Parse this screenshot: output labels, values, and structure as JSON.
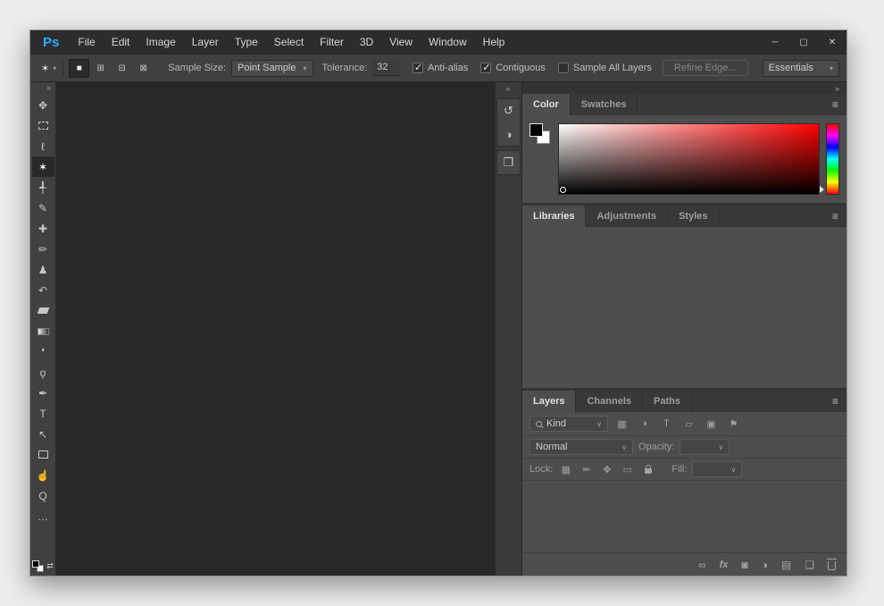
{
  "window": {
    "logo": "Ps",
    "minimize": "─",
    "maximize": "▢",
    "close": "✕"
  },
  "menubar": {
    "items": [
      "File",
      "Edit",
      "Image",
      "Layer",
      "Type",
      "Select",
      "Filter",
      "3D",
      "View",
      "Window",
      "Help"
    ]
  },
  "options": {
    "tool_icon_glyph": "✶",
    "caret": "▾",
    "selection_modes": [
      {
        "name": "new-selection",
        "glyph": "■"
      },
      {
        "name": "add-selection",
        "glyph": "⊞"
      },
      {
        "name": "subtract-selection",
        "glyph": "⊟"
      },
      {
        "name": "intersect-selection",
        "glyph": "⊠"
      }
    ],
    "sample_size_label": "Sample Size:",
    "sample_size_value": "Point Sample",
    "tolerance_label": "Tolerance:",
    "tolerance_value": "32",
    "anti_alias": {
      "label": "Anti-alias",
      "checked": true
    },
    "contiguous": {
      "label": "Contiguous",
      "checked": true
    },
    "sample_all_layers": {
      "label": "Sample All Layers",
      "checked": false
    },
    "refine_edge_label": "Refine Edge...",
    "workspace_value": "Essentials"
  },
  "toolbar": {
    "collapse": "»",
    "switch_colors_glyph": "⇄",
    "tools": [
      {
        "name": "move",
        "glyph": "✥"
      },
      {
        "name": "rectangular-marquee",
        "glyph": ""
      },
      {
        "name": "lasso",
        "glyph": "ℓ"
      },
      {
        "name": "magic-wand",
        "glyph": "✶",
        "selected": true
      },
      {
        "name": "crop",
        "glyph": "╃"
      },
      {
        "name": "eyedropper",
        "glyph": "✎"
      },
      {
        "name": "spot-healing-brush",
        "glyph": "✚"
      },
      {
        "name": "brush",
        "glyph": "✏"
      },
      {
        "name": "clone-stamp",
        "glyph": "♟"
      },
      {
        "name": "history-brush",
        "glyph": "↶"
      },
      {
        "name": "eraser",
        "glyph": ""
      },
      {
        "name": "gradient",
        "glyph": ""
      },
      {
        "name": "blur",
        "glyph": "❛"
      },
      {
        "name": "dodge",
        "glyph": "ϙ"
      },
      {
        "name": "pen",
        "glyph": "✒"
      },
      {
        "name": "type",
        "glyph": "T"
      },
      {
        "name": "path-selection",
        "glyph": "↖"
      },
      {
        "name": "rectangle",
        "glyph": ""
      },
      {
        "name": "hand",
        "glyph": "☝"
      },
      {
        "name": "zoom",
        "glyph": "Q"
      },
      {
        "name": "edit-toolbar",
        "glyph": "…"
      }
    ]
  },
  "dock_strip": {
    "collapse": "«",
    "panels": [
      {
        "name": "history",
        "glyph": "↺"
      },
      {
        "name": "adjustments",
        "glyph": "◑"
      },
      {
        "name": "info",
        "glyph": "❐"
      }
    ]
  },
  "dock": {
    "collapse": "»",
    "color": {
      "tabs": [
        "Color",
        "Swatches"
      ],
      "menu": "≡"
    },
    "libraries": {
      "tabs": [
        "Libraries",
        "Adjustments",
        "Styles"
      ],
      "menu": "≡"
    },
    "layers": {
      "tabs": [
        "Layers",
        "Channels",
        "Paths"
      ],
      "menu": "≡",
      "kind_label": "Kind",
      "caret": "∨",
      "filter_icons": [
        {
          "name": "pixel-layer-filter",
          "glyph": "▦"
        },
        {
          "name": "adjustment-layer-filter",
          "glyph": "◑"
        },
        {
          "name": "type-layer-filter",
          "glyph": "T"
        },
        {
          "name": "shape-layer-filter",
          "glyph": "▱"
        },
        {
          "name": "smart-object-filter",
          "glyph": "▣"
        }
      ],
      "filter_toggle_glyph": "⚑",
      "blend_mode_value": "Normal",
      "opacity_label": "Opacity:",
      "lock_label": "Lock:",
      "lock_icons": [
        {
          "name": "lock-transparency",
          "glyph": "▦"
        },
        {
          "name": "lock-image",
          "glyph": "✏"
        },
        {
          "name": "lock-position",
          "glyph": "✥"
        },
        {
          "name": "lock-artboard",
          "glyph": "▭"
        }
      ],
      "fill_label": "Fill:",
      "footer_icons": [
        {
          "name": "link-layers",
          "glyph": "∞"
        },
        {
          "name": "layer-style",
          "glyph": "fx"
        },
        {
          "name": "layer-mask",
          "glyph": "◙"
        },
        {
          "name": "adjustment-layer",
          "glyph": "◑"
        },
        {
          "name": "new-group",
          "glyph": "▤"
        },
        {
          "name": "new-layer",
          "glyph": "❏"
        }
      ]
    }
  },
  "colors": {
    "logo_blue": "#31a8ff",
    "canvas": "#282828",
    "panel": "#4d4d4d",
    "hue_base": "#ff0000"
  }
}
